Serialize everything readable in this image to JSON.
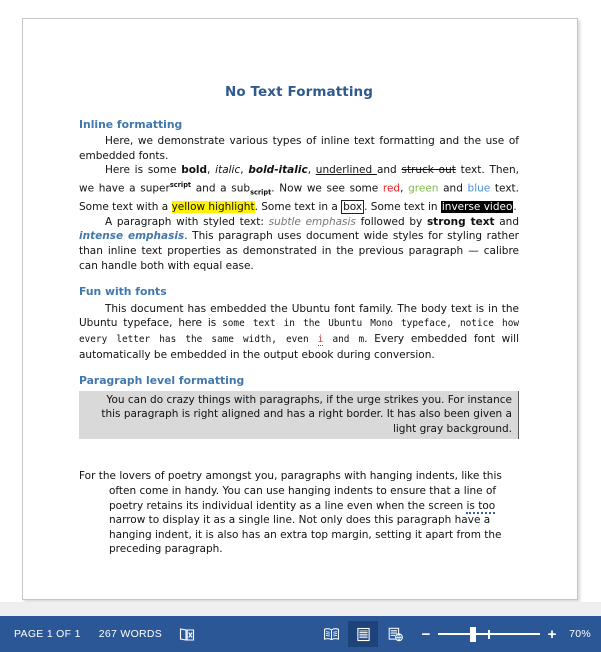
{
  "document": {
    "title": "No Text Formatting",
    "sections": [
      {
        "heading": "Inline formatting",
        "paragraphs": [
          "Here, we demonstrate various types of inline text formatting and the use of embedded fonts.",
          "Here is some bold, italic, bold-italic, underlined and struck out text. Then, we have a superscript and a subscript. Now we see some red, green and blue text. Some text with a yellow highlight. Some text in a box. Some text in inverse video.",
          "A paragraph with styled text: subtle emphasis followed by strong text and intense emphasis. This paragraph uses document wide styles for styling rather than inline text properties as demonstrated in the previous paragraph — calibre can handle both with equal ease."
        ]
      },
      {
        "heading": "Fun with fonts",
        "paragraphs": [
          "This document has embedded the Ubuntu font family. The body text is in the Ubuntu typeface, here is some text in the Ubuntu Mono typeface, notice how every letter has the same width, even i and m. Every embedded font will automatically be embedded in the output ebook during conversion."
        ]
      },
      {
        "heading": "Paragraph level formatting",
        "paragraphs": [
          "You can do crazy things with paragraphs, if the urge strikes you. For instance this paragraph is right aligned and has a right border. It has also been given a light gray background."
        ]
      }
    ],
    "hanging_paragraph": "For the lovers of poetry amongst you, paragraphs with hanging indents, like this often come in handy. You can use hanging indents to ensure that a line of poetry retains its individual identity as a line even when the screen is too narrow to display it as a single line. Not only does this paragraph have a hanging indent, it is also has an extra top margin, setting it apart from the preceding paragraph.",
    "inline_fragments": {
      "p1_lead": "Here, we demonstrate various types of inline text formatting and the use of embedded fonts.",
      "p2_a": "Here is some ",
      "p2_bold": "bold",
      "p2_b": ", ",
      "p2_italic": "italic",
      "p2_c": ", ",
      "p2_bolditalic": "bold-italic",
      "p2_d": ", ",
      "p2_underlined": "underlined ",
      "p2_e": "and ",
      "p2_struck": "struck out",
      "p2_f": " text. Then, we have a super",
      "p2_sup": "script",
      "p2_g": " and a sub",
      "p2_sub": "script",
      "p2_h": ". Now we see some ",
      "p2_red": "red",
      "p2_i": ", ",
      "p2_green": "green",
      "p2_j": " and ",
      "p2_blue": "blue",
      "p2_k": " text. Some text with a ",
      "p2_highlight": "yellow highlight",
      "p2_l": ". Some text in a ",
      "p2_box": "box",
      "p2_m": ". Some text in ",
      "p2_inverse": "inverse video",
      "p2_n": ".",
      "p3_a": "A paragraph with styled text: ",
      "p3_subtle": "subtle emphasis",
      "p3_b": " followed by ",
      "p3_strong": "strong text",
      "p3_c": " and ",
      "p3_intense": "intense emphasis",
      "p3_d": ". This paragraph uses document wide styles for styling rather than inline text properties as demonstrated in the previous paragraph — calibre can handle both with equal ease.",
      "fonts_a": "This document has embedded the Ubuntu font family. The body text is in the Ubuntu typeface, here is ",
      "fonts_mono1": "some text in the Ubuntu Mono typeface, notice how every letter has the same width, even ",
      "fonts_mono_i": "i",
      "fonts_mono2": " and m",
      "fonts_b": ". Every embedded font will automatically be embedded in the output ebook during conversion.",
      "hang_a": "For the lovers of poetry amongst you, paragraphs with hanging indents, like this often come in handy. You can use hanging indents to ensure that a line of poetry retains its individual identity as a line even when the screen ",
      "hang_grammar": "is too",
      "hang_b": " narrow to display it as a single line. Not only does this paragraph have a hanging indent, it is also has an extra top margin, setting it apart from the preceding paragraph."
    }
  },
  "status_bar": {
    "page_label": "PAGE 1 OF 1",
    "word_count": "267 WORDS",
    "proofing_icon": "proofing-errors-icon",
    "views": [
      {
        "name": "read-mode",
        "label": "Read Mode",
        "active": false
      },
      {
        "name": "print-layout",
        "label": "Print Layout",
        "active": true
      },
      {
        "name": "web-layout",
        "label": "Web Layout",
        "active": false
      }
    ],
    "zoom_out_label": "−",
    "zoom_in_label": "+",
    "zoom_level": "70%",
    "zoom_value": 70,
    "background_color": "#2B5797",
    "active_button_color": "#1E4379"
  },
  "colors": {
    "title_blue": "#2E5A8E",
    "heading_blue": "#4278AE",
    "text_red": "#ED1C24",
    "text_green": "#7FBA4C",
    "text_blue": "#4A90D9",
    "highlight_yellow": "#FFF200",
    "gray_box_bg": "#D9D9D9"
  }
}
